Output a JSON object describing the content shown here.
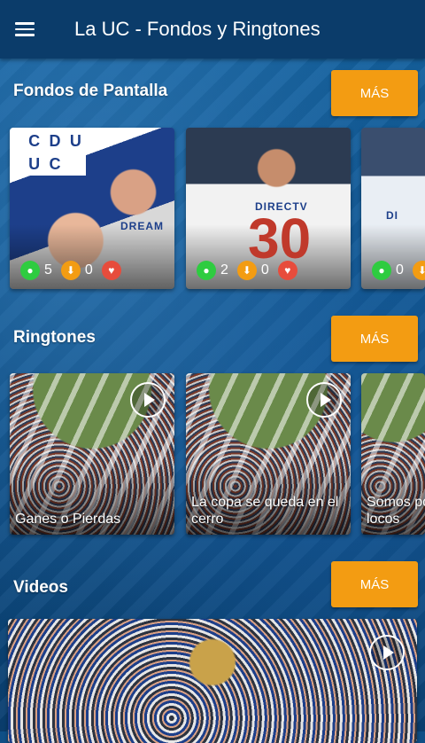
{
  "app": {
    "title": "La UC - Fondos y Ringtones"
  },
  "sections": {
    "wallpapers": {
      "title": "Fondos de Pantalla",
      "more": "MÁS",
      "items": [
        {
          "views": "5",
          "downloads": "0",
          "crest_letters": [
            "C",
            "D",
            "U",
            "U",
            "C",
            ""
          ],
          "sponsor": "DREAM"
        },
        {
          "views": "2",
          "downloads": "0",
          "jersey_number": "30",
          "sponsor": "DIRECTV"
        },
        {
          "views": "0",
          "sponsor": "DI"
        }
      ]
    },
    "ringtones": {
      "title": "Ringtones",
      "more": "MÁS",
      "items": [
        {
          "label": "Ganes o Pierdas"
        },
        {
          "label": "La copa se queda en el cerro"
        },
        {
          "label": "Somos pocos locos"
        }
      ]
    },
    "videos": {
      "title": "Videos",
      "more": "MÁS"
    }
  },
  "colors": {
    "appbar": "#0b3c6a",
    "accent": "#f39c12",
    "views": "#2ecc40",
    "likes": "#e74c3c"
  }
}
